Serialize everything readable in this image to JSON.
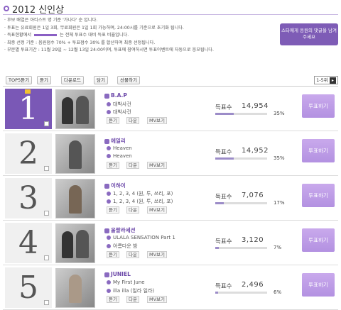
{
  "header": {
    "title": "2012 신인상"
  },
  "notice": {
    "lines": [
      "후보 배열은 아티스트 명 기준 '가나다' 순 입니다.",
      "투표는 유료회원은 1일 3회, 무료회원은 1일 1회 가능하며, 24:00시를 기준으로 초기화 됩니다.",
      "득표현황에서 [bar] 는 전체 투표수 대비 득표 비율입니다.",
      "최종 선정 기준 : 음원점수 70% + 투표점수 30% 를 합산하여 최종 선정됩니다.",
      "부문별 투표기간 : 11월 29일 ~ 12월 13일 24:00이며, 투표에 참여하시면 투표이벤트에 자동으로 응모됩니다."
    ],
    "cta_label": "스타에게 응원의 댓글을 남겨주세요"
  },
  "tabs": [
    {
      "label": "TOP5듣기"
    },
    {
      "label": "듣기"
    },
    {
      "label": "다운로드"
    },
    {
      "label": "담기"
    },
    {
      "label": "선물하기"
    }
  ],
  "range": {
    "label": "1-5위"
  },
  "rows": [
    {
      "rank": "1",
      "artist": "B.A.P",
      "songs": [
        "대박사건",
        "대박사건"
      ],
      "votes_label": "득표수",
      "votes": "14,954",
      "pct": "35%",
      "pct_value": 0.35,
      "vote_btn": "투표하기",
      "mini": [
        "듣기",
        "다운",
        "MV보기"
      ]
    },
    {
      "rank": "2",
      "artist": "에일리",
      "songs": [
        "Heaven",
        "Heaven"
      ],
      "votes_label": "득표수",
      "votes": "14,952",
      "pct": "35%",
      "pct_value": 0.35,
      "vote_btn": "투표하기",
      "mini": [
        "듣기",
        "다운",
        "MV보기"
      ]
    },
    {
      "rank": "3",
      "artist": "이하이",
      "songs": [
        "1, 2, 3, 4 (원, 투, 쓰리, 포)",
        "1, 2, 3, 4 (원, 투, 쓰리, 포)"
      ],
      "votes_label": "득표수",
      "votes": "7,076",
      "pct": "17%",
      "pct_value": 0.17,
      "vote_btn": "투표하기",
      "mini": [
        "듣기",
        "다운",
        "MV보기"
      ]
    },
    {
      "rank": "4",
      "artist": "울랄라세션",
      "songs": [
        "ULALA SENSATION Part 1",
        "아름다운 밤"
      ],
      "votes_label": "득표수",
      "votes": "3,120",
      "pct": "7%",
      "pct_value": 0.07,
      "vote_btn": "투표하기",
      "mini": [
        "듣기",
        "다운",
        "MV보기"
      ]
    },
    {
      "rank": "5",
      "artist": "JUNIEL",
      "songs": [
        "My First June",
        "illa illa (일라 일라)"
      ],
      "votes_label": "득표수",
      "votes": "2,496",
      "pct": "6%",
      "pct_value": 0.06,
      "vote_btn": "투표하기",
      "mini": [
        "듣기",
        "다운",
        "MV보기"
      ]
    }
  ],
  "colors": {
    "accent": "#7a58b6",
    "vote_button": "#b391e1"
  }
}
